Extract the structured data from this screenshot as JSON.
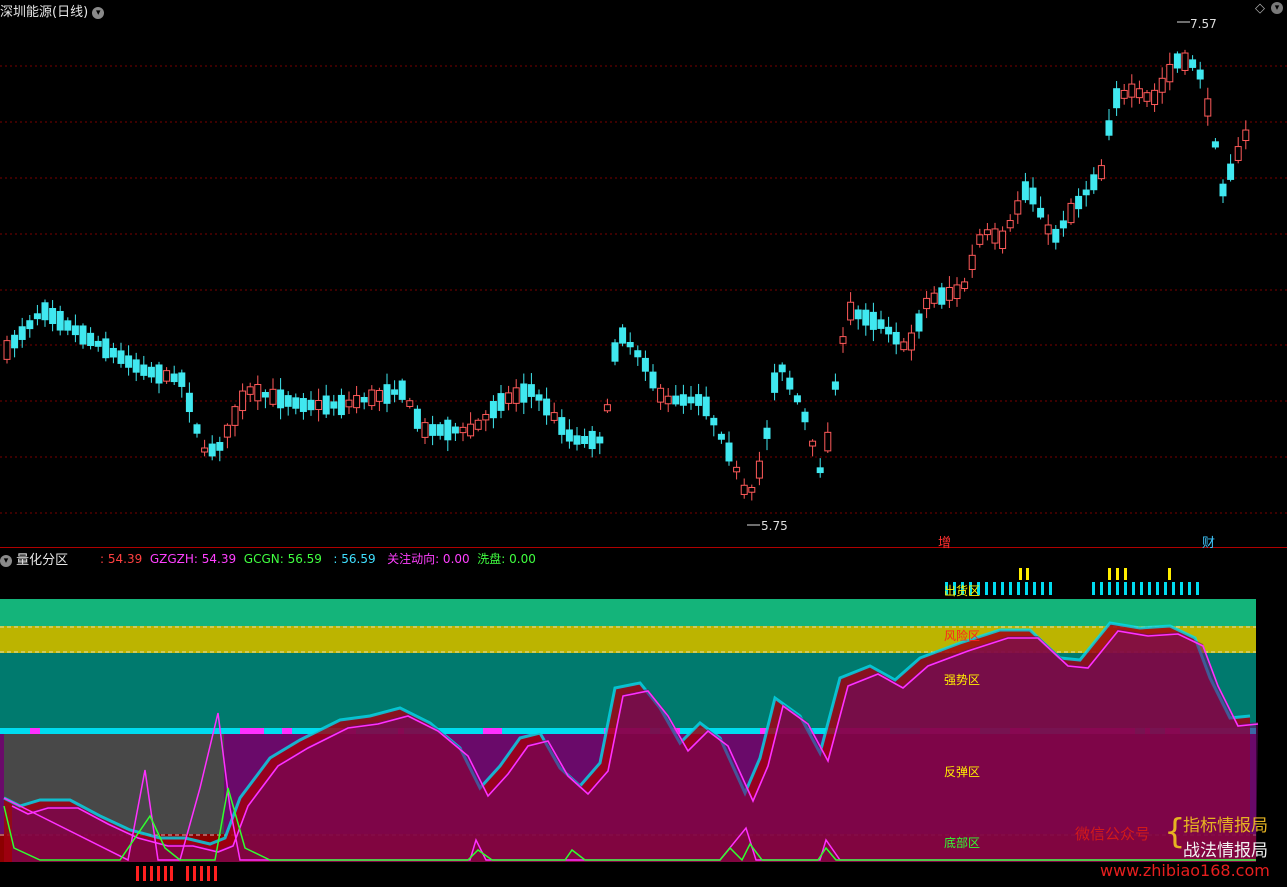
{
  "main": {
    "title": "深圳能源(日线)",
    "high_label": "7.57",
    "low_label": "5.75",
    "marker_zeng": "增",
    "marker_cai": "财"
  },
  "sub": {
    "title": "量化分区",
    "readouts": [
      {
        "text": ": 54.39",
        "color": "#ff4040"
      },
      {
        "text": "GZGZH: 54.39",
        "color": "#ff40ff"
      },
      {
        "text": "GCGN: 56.59",
        "color": "#40ff40"
      },
      {
        "text": ": 56.59",
        "color": "#40e0ff"
      },
      {
        "text": "关注动向: 0.00",
        "color": "#ff40ff"
      },
      {
        "text": "洗盘: 0.00",
        "color": "#40ff40"
      }
    ],
    "zones": {
      "chuhuo": "出货区",
      "risk": "风险区",
      "strong": "强势区",
      "rebound": "反弹区",
      "bottom": "底部区"
    },
    "colors": {
      "top_band": "#14b47a",
      "risk_band": "#bcb400",
      "strong_band": "#007a6e",
      "rebound_band": "#6a0a6a",
      "bottom_band": "#8c0000",
      "cyan_line": "#00dcf0",
      "magenta_line": "#ff30ff",
      "green_line": "#30ff30"
    }
  },
  "watermark": {
    "line1": "微信公众号",
    "line2": "指标情报局",
    "line3": "战法情报局",
    "url": "www.zhibiao168.com"
  }
}
